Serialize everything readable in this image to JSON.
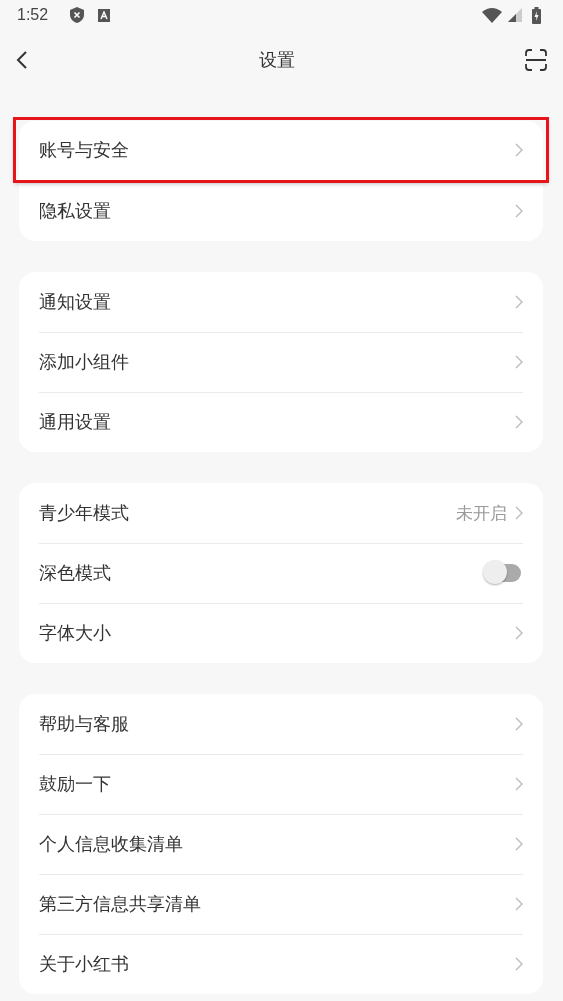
{
  "status_bar": {
    "time": "1:52"
  },
  "header": {
    "title": "设置"
  },
  "groups": [
    {
      "items": [
        {
          "kind": "link",
          "label": "账号与安全",
          "highlighted": true
        },
        {
          "kind": "link",
          "label": "隐私设置",
          "highlighted": false
        }
      ]
    },
    {
      "items": [
        {
          "kind": "link",
          "label": "通知设置",
          "highlighted": false
        },
        {
          "kind": "link",
          "label": "添加小组件",
          "highlighted": false
        },
        {
          "kind": "link",
          "label": "通用设置",
          "highlighted": false
        }
      ]
    },
    {
      "items": [
        {
          "kind": "link",
          "label": "青少年模式",
          "value": "未开启",
          "highlighted": false
        },
        {
          "kind": "toggle",
          "label": "深色模式",
          "on": false,
          "highlighted": false
        },
        {
          "kind": "link",
          "label": "字体大小",
          "highlighted": false
        }
      ]
    },
    {
      "items": [
        {
          "kind": "link",
          "label": "帮助与客服",
          "highlighted": false
        },
        {
          "kind": "link",
          "label": "鼓励一下",
          "highlighted": false
        },
        {
          "kind": "link",
          "label": "个人信息收集清单",
          "highlighted": false
        },
        {
          "kind": "link",
          "label": "第三方信息共享清单",
          "highlighted": false
        },
        {
          "kind": "link",
          "label": "关于小红书",
          "highlighted": false
        }
      ]
    }
  ]
}
